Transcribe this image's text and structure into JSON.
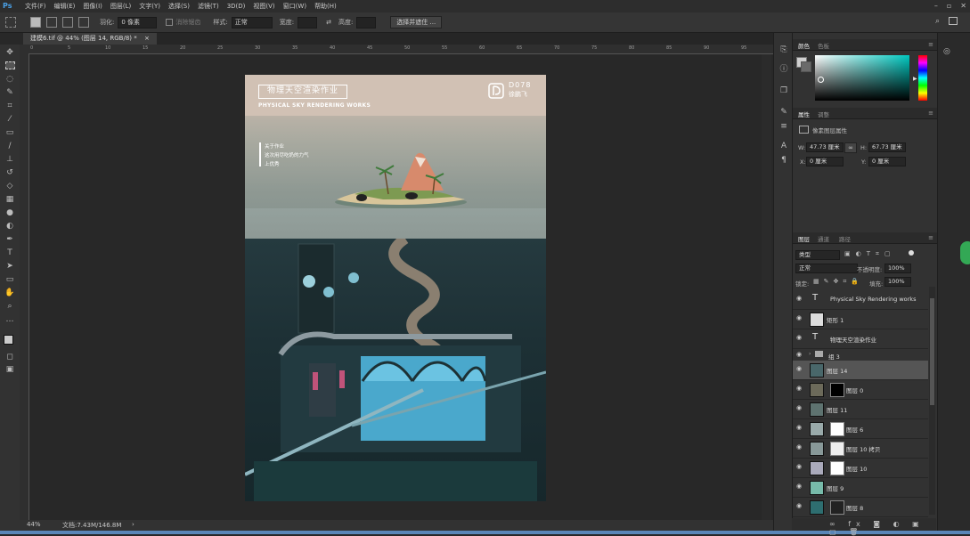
{
  "app": {
    "logo": "Ps"
  },
  "menu": [
    "文件(F)",
    "编辑(E)",
    "图像(I)",
    "图层(L)",
    "文字(Y)",
    "选择(S)",
    "滤镜(T)",
    "3D(D)",
    "视图(V)",
    "窗口(W)",
    "帮助(H)"
  ],
  "window_controls": {
    "minimize": "–",
    "restore": "▫",
    "close": "✕"
  },
  "options": {
    "feather_label": "羽化:",
    "feather_value": "0 像素",
    "antialias_label": "消除锯齿",
    "style_label": "样式:",
    "style_value": "正常",
    "width_label": "宽度:",
    "height_label": "高度:",
    "select_mask_button": "选择并遮住 ..."
  },
  "document_tab": {
    "title": "建模6.tif @ 44% (图层 14, RGB/8) *",
    "close": "×"
  },
  "ruler_top_ticks": [
    "0",
    "5",
    "10",
    "15",
    "20",
    "25",
    "30",
    "35",
    "40",
    "45",
    "50",
    "55",
    "60",
    "65",
    "70",
    "75",
    "80",
    "85",
    "90",
    "95"
  ],
  "status": {
    "zoom": "44%",
    "doc": "文档:7.43M/146.8M",
    "arrow": "›"
  },
  "artwork": {
    "title_cn": "物理天空渲染作业",
    "title_en": "PHYSICAL SKY RENDERING WORKS",
    "code": "D078",
    "author": "徐鹏飞",
    "notes": [
      "关于作业",
      "这次用尽吃奶的力气",
      "上优秀"
    ]
  },
  "panel_color": {
    "tab_active": "颜色",
    "tab_inactive": "色板"
  },
  "panel_props": {
    "tab_active": "属性",
    "tab_inactive": "调整",
    "section": "像素图层属性",
    "w_label": "W:",
    "w_value": "47.73 厘米",
    "h_label": "H:",
    "h_value": "67.73 厘米",
    "x_label": "X:",
    "x_value": "0 厘米",
    "y_label": "Y:",
    "y_value": "0 厘米"
  },
  "panel_layers": {
    "tabs": [
      "图层",
      "通道",
      "路径"
    ],
    "filter": "类型",
    "blend": "正常",
    "opacity_label": "不透明度:",
    "opacity": "100%",
    "lock_label": "锁定:",
    "fill_label": "填充:",
    "fill": "100%",
    "layers": [
      {
        "name": "Physical Sky Rendering works",
        "kind": "text"
      },
      {
        "name": "矩形 1",
        "kind": "shape"
      },
      {
        "name": "物理天空渲染作业",
        "kind": "text"
      },
      {
        "name": "组 3",
        "kind": "group"
      },
      {
        "name": "图层 14",
        "kind": "pixel",
        "selected": true
      },
      {
        "name": "图层 0",
        "kind": "masked"
      },
      {
        "name": "图层 11",
        "kind": "pixel"
      },
      {
        "name": "图层 6",
        "kind": "masked"
      },
      {
        "name": "图层 10 拷贝",
        "kind": "masked"
      },
      {
        "name": "图层 10",
        "kind": "masked"
      },
      {
        "name": "图层 9",
        "kind": "pixel"
      },
      {
        "name": "图层 8",
        "kind": "masked"
      }
    ]
  },
  "colors": {
    "ps_blue": "#4aa0e6",
    "selected_layer": "#555555",
    "accent_cyan": "#00c8c0"
  }
}
